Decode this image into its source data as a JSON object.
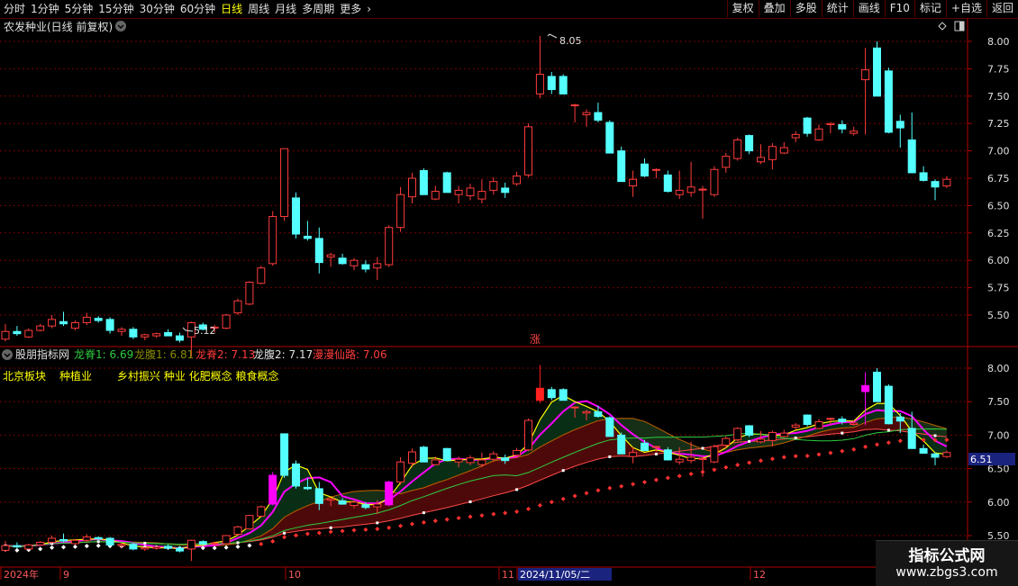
{
  "toolbar": {
    "periods": [
      "分时",
      "1分钟",
      "5分钟",
      "15分钟",
      "30分钟",
      "60分钟",
      "日线",
      "周线",
      "月线",
      "多周期",
      "更多"
    ],
    "active_period": "日线",
    "more_icon": "chevron-right-icon",
    "buttons": [
      "复权",
      "叠加",
      "多股",
      "统计",
      "画线",
      "F10",
      "标记",
      "+自选",
      "返回"
    ]
  },
  "main_chart": {
    "title": "农发种业(日线 前复权)",
    "title_icon": "chevron-down-circle-icon",
    "corner_icons": [
      "diamond-icon",
      "window-icon"
    ],
    "price_axis": [
      "8.00",
      "7.75",
      "7.50",
      "7.25",
      "7.00",
      "6.75",
      "6.50",
      "6.25",
      "6.00",
      "5.75",
      "5.50"
    ],
    "high_label": "8.05",
    "low_label": "5.12",
    "limit_up_badge": "涨"
  },
  "indicator": {
    "name": "股朋指标网",
    "name_icon": "chevron-down-circle-icon",
    "legend": [
      {
        "label": "龙脊1: 6.69",
        "color": "#2ecc40"
      },
      {
        "label": "龙腹1: 6.81",
        "color": "#8a8a00"
      },
      {
        "label": "龙脊2: 7.13",
        "color": "#ff3b3b"
      },
      {
        "label": "龙腹2: 7.17",
        "color": "#e0e0e0"
      },
      {
        "label": "漫漫仙路: 7.06",
        "color": "#ff3b3b"
      }
    ],
    "sectors": [
      "北京板块",
      "种植业",
      "乡村振兴 种业 化肥概念 粮食概念"
    ],
    "price_axis": [
      "8.00",
      "7.50",
      "7.00",
      "6.50",
      "6.00",
      "5.50"
    ],
    "current_price": "6.51"
  },
  "date_axis": [
    "2024年",
    "9",
    "10",
    "11",
    "2024/11/05/二",
    "12"
  ],
  "watermark": {
    "title": "指标公式网",
    "url": "www.zbgs3.com"
  },
  "colors": {
    "up": "#ff3b3b",
    "down": "#54ffff",
    "grid": "#7a0000",
    "axis": "#b00000",
    "limit_up": "#ff00ff"
  },
  "chart_data": {
    "type": "candlestick",
    "ylim": [
      5.28,
      8.12
    ],
    "bars": [
      [
        5.28,
        5.42,
        5.26,
        5.35
      ],
      [
        5.35,
        5.4,
        5.31,
        5.33
      ],
      [
        5.3,
        5.38,
        5.29,
        5.36
      ],
      [
        5.36,
        5.42,
        5.35,
        5.4
      ],
      [
        5.4,
        5.5,
        5.38,
        5.46
      ],
      [
        5.44,
        5.53,
        5.4,
        5.42
      ],
      [
        5.38,
        5.45,
        5.36,
        5.43
      ],
      [
        5.43,
        5.52,
        5.41,
        5.48
      ],
      [
        5.47,
        5.49,
        5.43,
        5.45
      ],
      [
        5.46,
        5.48,
        5.33,
        5.36
      ],
      [
        5.35,
        5.39,
        5.31,
        5.37
      ],
      [
        5.37,
        5.39,
        5.28,
        5.3
      ],
      [
        5.3,
        5.33,
        5.27,
        5.32
      ],
      [
        5.31,
        5.34,
        5.29,
        5.33
      ],
      [
        5.34,
        5.37,
        5.32,
        5.31
      ],
      [
        5.31,
        5.34,
        5.25,
        5.27
      ],
      [
        5.3,
        5.44,
        5.12,
        5.43
      ],
      [
        5.41,
        5.43,
        5.36,
        5.37
      ],
      [
        5.38,
        5.41,
        5.34,
        5.39
      ],
      [
        5.38,
        5.51,
        5.37,
        5.5
      ],
      [
        5.52,
        5.65,
        5.5,
        5.63
      ],
      [
        5.6,
        5.81,
        5.59,
        5.8
      ],
      [
        5.79,
        5.95,
        5.78,
        5.93
      ],
      [
        5.97,
        6.45,
        5.95,
        6.4
      ],
      [
        6.4,
        6.9,
        6.36,
        7.02
      ],
      [
        6.57,
        6.62,
        6.2,
        6.24
      ],
      [
        6.22,
        6.36,
        6.18,
        6.2
      ],
      [
        6.2,
        6.3,
        5.88,
        5.98
      ],
      [
        6.03,
        6.07,
        5.94,
        6.05
      ],
      [
        6.02,
        6.06,
        5.96,
        5.97
      ],
      [
        5.95,
        6.02,
        5.91,
        6.0
      ],
      [
        5.96,
        6.0,
        5.89,
        5.92
      ],
      [
        5.93,
        6.03,
        5.82,
        5.97
      ],
      [
        5.96,
        6.32,
        5.94,
        6.3
      ],
      [
        6.3,
        6.67,
        6.26,
        6.6
      ],
      [
        6.58,
        6.8,
        6.52,
        6.75
      ],
      [
        6.82,
        6.84,
        6.6,
        6.6
      ],
      [
        6.56,
        6.68,
        6.55,
        6.63
      ],
      [
        6.8,
        6.81,
        6.64,
        6.62
      ],
      [
        6.6,
        6.68,
        6.52,
        6.64
      ],
      [
        6.59,
        6.7,
        6.55,
        6.66
      ],
      [
        6.56,
        6.74,
        6.52,
        6.63
      ],
      [
        6.64,
        6.76,
        6.6,
        6.72
      ],
      [
        6.66,
        6.71,
        6.57,
        6.62
      ],
      [
        6.7,
        6.81,
        6.68,
        6.77
      ],
      [
        6.78,
        7.25,
        6.76,
        7.22
      ],
      [
        7.52,
        8.05,
        7.48,
        7.7
      ],
      [
        7.68,
        7.72,
        7.52,
        7.56
      ],
      [
        7.68,
        7.7,
        7.55,
        7.52
      ],
      [
        7.42,
        7.43,
        7.26,
        7.42
      ],
      [
        7.33,
        7.38,
        7.22,
        7.35
      ],
      [
        7.35,
        7.44,
        7.26,
        7.28
      ],
      [
        7.26,
        7.28,
        6.98,
        6.98
      ],
      [
        7.0,
        7.04,
        6.72,
        6.72
      ],
      [
        6.68,
        6.82,
        6.58,
        6.74
      ],
      [
        6.88,
        6.93,
        6.76,
        6.77
      ],
      [
        6.83,
        6.84,
        6.75,
        6.83
      ],
      [
        6.78,
        6.82,
        6.62,
        6.63
      ],
      [
        6.6,
        6.82,
        6.56,
        6.64
      ],
      [
        6.62,
        6.9,
        6.58,
        6.67
      ],
      [
        6.65,
        6.68,
        6.38,
        6.65
      ],
      [
        6.6,
        6.86,
        6.58,
        6.83
      ],
      [
        6.85,
        6.98,
        6.8,
        6.95
      ],
      [
        6.93,
        7.12,
        6.91,
        7.1
      ],
      [
        7.14,
        7.15,
        6.97,
        7.0
      ],
      [
        6.9,
        7.06,
        6.88,
        6.94
      ],
      [
        6.92,
        7.07,
        6.83,
        7.04
      ],
      [
        6.98,
        7.08,
        6.97,
        7.03
      ],
      [
        7.12,
        7.18,
        7.08,
        7.15
      ],
      [
        7.3,
        7.31,
        7.13,
        7.16
      ],
      [
        7.1,
        7.24,
        7.09,
        7.2
      ],
      [
        7.24,
        7.26,
        7.16,
        7.25
      ],
      [
        7.24,
        7.28,
        7.16,
        7.2
      ],
      [
        7.16,
        7.22,
        7.14,
        7.18
      ],
      [
        7.65,
        7.94,
        7.15,
        7.74
      ],
      [
        7.94,
        8.0,
        7.5,
        7.5
      ],
      [
        7.73,
        7.76,
        7.16,
        7.17
      ],
      [
        7.27,
        7.33,
        7.03,
        7.21
      ],
      [
        7.1,
        7.35,
        6.98,
        6.8
      ],
      [
        6.8,
        6.86,
        6.72,
        6.73
      ],
      [
        6.72,
        6.74,
        6.55,
        6.67
      ],
      [
        6.68,
        6.77,
        6.66,
        6.74
      ]
    ]
  }
}
